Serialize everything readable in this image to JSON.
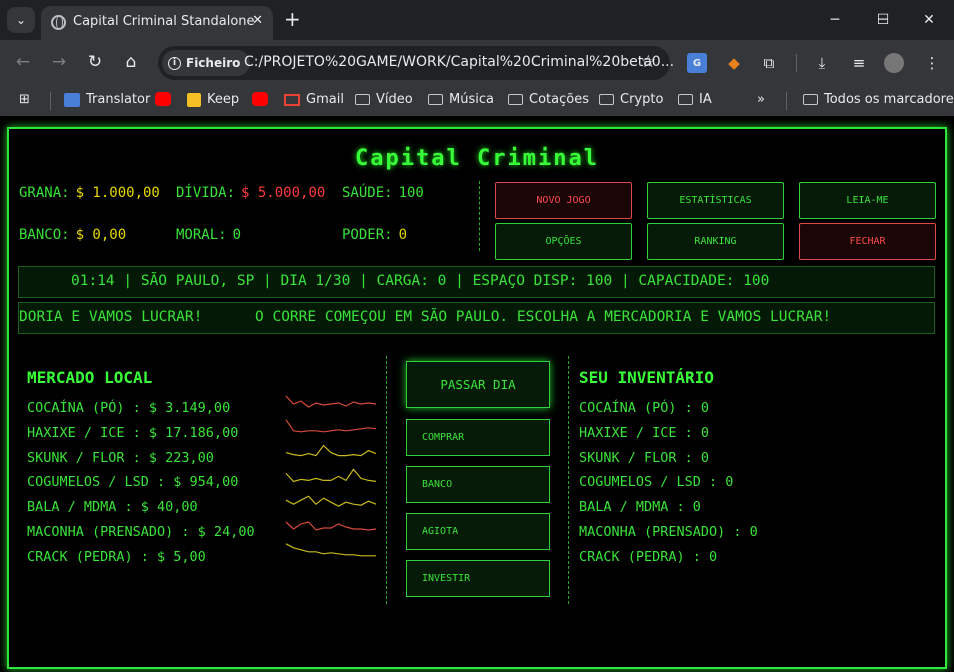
{
  "browser": {
    "tab_title": "Capital Criminal Standalone",
    "site_chip": "Ficheiro",
    "url": "C:/PROJETO%20GAME/WORK/Capital%20Criminal%20beta0...",
    "bookmarks": [
      "Translator",
      "Keep",
      "Gmail",
      "Vídeo",
      "Música",
      "Cotações",
      "Crypto",
      "IA"
    ],
    "all_bookmarks": "Todos os marcadores"
  },
  "game": {
    "title": "Capital Criminal",
    "stats": {
      "grana_label": "GRANA:",
      "grana_value": "$ 1.000,00",
      "divida_label": "DÍVIDA:",
      "divida_value": "$ 5.000,00",
      "saude_label": "SAÚDE:",
      "saude_value": "100",
      "banco_label": "BANCO:",
      "banco_value": "$ 0,00",
      "moral_label": "MORAL:",
      "moral_value": "0",
      "poder_label": "PODER:",
      "poder_value": "0"
    },
    "menu": {
      "novo_jogo": "NOVO JOGO",
      "estatisticas": "ESTATÍSTICAS",
      "leia_me": "LEIA-ME",
      "opcoes": "OPÇÕES",
      "ranking": "RANKING",
      "fechar": "FECHAR"
    },
    "status_bar": "01:14 | SÃO PAULO, SP | DIA 1/30 | CARGA: 0 | ESPAÇO DISP: 100 | CAPACIDADE: 100",
    "ticker_a": "DORIA E VAMOS LUCRAR!",
    "ticker_b": "O CORRE COMEÇOU EM SÃO PAULO. ESCOLHA A MERCADORIA E VAMOS LUCRAR!",
    "market": {
      "title": "MERCADO LOCAL",
      "items": [
        {
          "label": "COCAÍNA (PÓ) : $ 3.149,00",
          "trend": "red",
          "spark": [
            5,
            13,
            10,
            16,
            12,
            14,
            13,
            12,
            15,
            11,
            13,
            12,
            13
          ]
        },
        {
          "label": "HAXIXE / ICE : $ 17.186,00",
          "trend": "red",
          "spark": [
            4,
            15,
            16,
            15,
            15,
            16,
            15,
            14,
            15,
            14,
            13,
            12,
            13
          ]
        },
        {
          "label": "SKUNK / FLOR : $ 223,00",
          "trend": "yellow",
          "spark": [
            12,
            14,
            15,
            13,
            15,
            5,
            12,
            15,
            15,
            14,
            15,
            10,
            13
          ]
        },
        {
          "label": "COGUMELOS / LSD : $ 954,00",
          "trend": "yellow",
          "spark": [
            8,
            16,
            14,
            15,
            13,
            15,
            15,
            11,
            15,
            4,
            13,
            15,
            16
          ]
        },
        {
          "label": "BALA / MDMA : $ 40,00",
          "trend": "yellow",
          "spark": [
            10,
            14,
            10,
            6,
            14,
            8,
            12,
            16,
            12,
            14,
            15,
            11,
            14
          ]
        },
        {
          "label": "MACONHA (PRENSADO) : $ 24,00",
          "trend": "red",
          "spark": [
            7,
            14,
            9,
            7,
            15,
            13,
            13,
            9,
            12,
            14,
            14,
            15,
            14
          ]
        },
        {
          "label": "CRACK (PEDRA) : $ 5,00",
          "trend": "yellow",
          "spark": [
            4,
            8,
            10,
            12,
            12,
            14,
            13,
            14,
            15,
            15,
            16,
            16,
            16
          ]
        }
      ]
    },
    "actions": {
      "passar_dia": "PASSAR DIA",
      "comprar": "COMPRAR",
      "banco": "BANCO",
      "agiota": "AGIOTA",
      "investir": "INVESTIR"
    },
    "inventory": {
      "title": "SEU INVENTÁRIO",
      "items": [
        "COCAÍNA (PÓ) : 0",
        "HAXIXE / ICE : 0",
        "SKUNK / FLOR : 0",
        "COGUMELOS / LSD : 0",
        "BALA / MDMA : 0",
        "MACONHA (PRENSADO) : 0",
        "CRACK (PEDRA) : 0"
      ]
    },
    "colors": {
      "green": "#39e339",
      "yellow": "#e6d800",
      "red": "#ff3b3b",
      "spark_red": "#d64a3a",
      "spark_yellow": "#c8b820"
    }
  }
}
